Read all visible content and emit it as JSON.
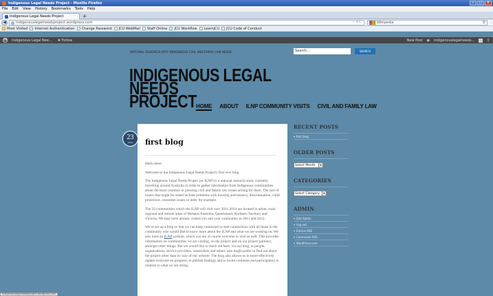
{
  "browser": {
    "window_title": "Indigenous Legal Needs Project - Mozilla Firefox",
    "menu": [
      "File",
      "Edit",
      "View",
      "History",
      "Bookmarks",
      "Tools",
      "Help"
    ],
    "tab_title": "Indigenous Legal Needs Project",
    "new_tab": "+",
    "url": "indigenouslegalneedsproject.wordpress.com",
    "search_engine": "Wikipedia",
    "bookmarks": [
      "Most Visited",
      "Internet Authentication",
      "Change Password",
      "JCU WebMail",
      "Staff Online",
      "JCU Workflow",
      "LearnJCU",
      "JCU Code of Conduct"
    ],
    "status_url": "indigenouslegalneedsproject.wordpress.com"
  },
  "adminbar": {
    "site_name": "Indigenous Legal Nee...",
    "follow": "Follow",
    "new_post": "New Post",
    "user": "indigenouslegalneeds..."
  },
  "header": {
    "tagline": "NATIONAL RESEARCH INTO INDIGENOUS CIVIL AND FAMILY LAW NEEDS",
    "search_placeholder": "Search...",
    "search_button": "SEARCH",
    "title_line1": "INDIGENOUS LEGAL NEEDS",
    "title_line2": "PROJECT"
  },
  "nav": [
    "HOME",
    "ABOUT",
    "ILNP COMMUNITY VISITS",
    "CIVIL AND FAMILY LAW"
  ],
  "post": {
    "day": "23",
    "month": "AUG",
    "title": "first blog",
    "paragraphs": [
      "Hello there.",
      "Welcome to the Indigenous Legal Needs Project's first ever blog.",
      "The Indigenous Legal Needs Project (or ILNP) is a national research study currently travelling around Australia in order to gather information from Indigenous communities about the most common or pressing civil and family law issues arising for them. The sort of issues that might be raised include problems with housing and tenancy, discrimination, child protection, consumer issues or debt, for example.",
      "The 32 communities which the ILNP will visit over 2011-2014 are located in urban, rural, regional and remote areas of Western Australia, Queensland, Northern Territory and Victoria. We may have already visited you and your community in 2011 and 2012.",
      "We've set up a blog so that we can keep connected or start connections with all those in the community who would like to know more about the ILNP and what we are working on. We also have an ILNP website, which you are of course welcome to visit as well. This provides information on communities we are visiting, on the project and on our project partners, amongst other things. But we would like to reach out here, via our blog, to people, organisations, service providers, researchers and others who might prefer to find out about the project other than by way of our website. The blog also allows us to more effectively update everyone on progress, to publish findings and to invite comment and participation in relation to what we are doing."
    ],
    "link_word": "ILNP"
  },
  "sidebar": {
    "recent_title": "RECENT POSTS",
    "recent_items": [
      "first blog"
    ],
    "older_title": "OLDER POSTS",
    "older_select": "Select Month",
    "categories_title": "CATEGORIES",
    "categories_select": "Select Category",
    "admin_title": "ADMIN",
    "admin_items": [
      "Site Admin",
      "Log out",
      "Entries RSS",
      "Comments RSS",
      "WordPress.com"
    ]
  }
}
